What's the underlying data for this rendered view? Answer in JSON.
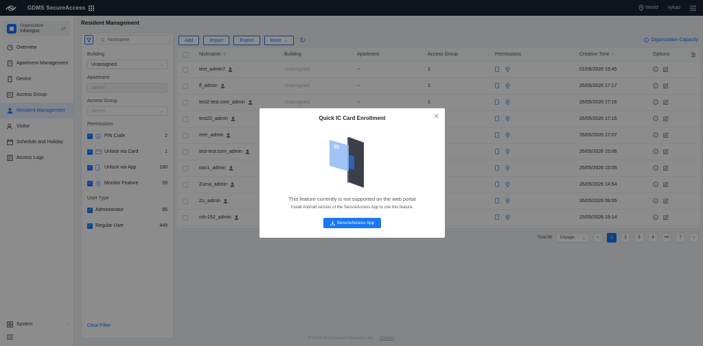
{
  "topbar": {
    "app_title": "GDMS SecureAccess",
    "location": "World",
    "user": "xykao"
  },
  "sidebar": {
    "org_label": "Organization",
    "org_name": "Inhongus",
    "items": [
      {
        "label": "Overview",
        "icon": "overview-icon"
      },
      {
        "label": "Apartment Management",
        "icon": "apartment-icon"
      },
      {
        "label": "Device",
        "icon": "device-icon"
      },
      {
        "label": "Access Group",
        "icon": "access-group-icon"
      },
      {
        "label": "Resident Management",
        "icon": "resident-icon",
        "active": true
      },
      {
        "label": "Visitor",
        "icon": "visitor-icon"
      },
      {
        "label": "Schedule and Holiday",
        "icon": "calendar-icon"
      },
      {
        "label": "Access Logs",
        "icon": "logs-icon"
      }
    ],
    "system_label": "System"
  },
  "page": {
    "title": "Resident Management",
    "org_capacity": "Organization Capacity"
  },
  "filter": {
    "search_placeholder": "Nickname",
    "building_label": "Building",
    "building_value": "Unassigned",
    "apartment_label": "Apartment",
    "apartment_placeholder": "Select",
    "access_group_label": "Access Group",
    "access_group_placeholder": "Select",
    "permissions_label": "Permissions",
    "permissions": [
      {
        "label": "PIN Code",
        "count": "2"
      },
      {
        "label": "Unlock via Card",
        "count": "1"
      },
      {
        "label": "Unlock via App",
        "count": "160"
      },
      {
        "label": "Monitor Feature",
        "count": "59"
      }
    ],
    "user_type_label": "User Type",
    "user_types": [
      {
        "label": "Administrator",
        "count": "85"
      },
      {
        "label": "Regular User",
        "count": "449"
      }
    ],
    "clear_label": "Clear Filter"
  },
  "toolbar": {
    "add": "Add",
    "import": "Import",
    "export": "Export",
    "more": "More"
  },
  "table": {
    "headers": {
      "nickname": "Nickname",
      "building": "Building",
      "apartment": "Apartment",
      "access_group": "Access Group",
      "permissions": "Permissions",
      "creation_time": "Creation Time",
      "options": "Options"
    },
    "rows": [
      {
        "nickname": "test_admin7",
        "building": "Unassigned",
        "apartment": "--",
        "access_group": "1",
        "created": "01/06/2026 19:45"
      },
      {
        "nickname": "ff_admin",
        "building": "Unassigned",
        "apartment": "--",
        "access_group": "1",
        "created": "26/05/2026 17:17"
      },
      {
        "nickname": "test2-test.com_admin",
        "building": "Unassigned",
        "apartment": "--",
        "access_group": "1",
        "created": "26/05/2026 17:16"
      },
      {
        "nickname": "test22_admin",
        "building": "",
        "apartment": "",
        "access_group": "",
        "created": "26/05/2026 17:16"
      },
      {
        "nickname": "erer_admin",
        "building": "",
        "apartment": "",
        "access_group": "",
        "created": "26/05/2026 17:07"
      },
      {
        "nickname": "test-test.com_admin",
        "building": "",
        "apartment": "",
        "access_group": "",
        "created": "26/05/2026 15:06"
      },
      {
        "nickname": "ooo1_admin",
        "building": "",
        "apartment": "",
        "access_group": "",
        "created": "26/05/2026 15:05"
      },
      {
        "nickname": "Zuma_admin",
        "building": "",
        "apartment": "",
        "access_group": "",
        "created": "26/05/2026 14:54"
      },
      {
        "nickname": "Zu_admin",
        "building": "",
        "apartment": "",
        "access_group": "",
        "created": "26/05/2026 09:55"
      },
      {
        "nickname": "mh-152_admin",
        "building": "",
        "apartment": "",
        "access_group": "",
        "created": "25/05/2026 19:14"
      }
    ]
  },
  "pagination": {
    "total": "Total 68",
    "page_size": "10/page",
    "pages": [
      "1",
      "2",
      "3",
      "4"
    ],
    "ellipsis": "•••",
    "last": "7"
  },
  "footer": {
    "copyright": "© 2026 Grandstream Networks, Inc.",
    "cookies": "Cookies"
  },
  "modal": {
    "title": "Quick IC Card Enrollment",
    "message": "This feature currently is not supported on the web portal",
    "sub": "Install Android version of the SecureAccess App to use this feature.",
    "button": "SecureAccess App"
  },
  "colors": {
    "accent": "#1677ff",
    "topbar": "#1d2533"
  }
}
